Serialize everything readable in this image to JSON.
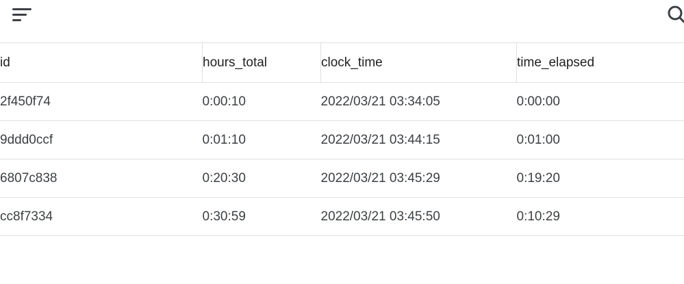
{
  "toolbar": {
    "menu_icon": "filter-list-icon",
    "search_icon": "search-icon"
  },
  "table": {
    "columns": [
      "id",
      "hours_total",
      "clock_time",
      "time_elapsed"
    ],
    "rows": [
      [
        "2f450f74",
        "0:00:10",
        "2022/03/21 03:34:05",
        "0:00:00"
      ],
      [
        "9ddd0ccf",
        "0:01:10",
        "2022/03/21 03:44:15",
        "0:01:00"
      ],
      [
        "6807c838",
        "0:20:30",
        "2022/03/21 03:45:29",
        "0:19:20"
      ],
      [
        "cc8f7334",
        "0:30:59",
        "2022/03/21 03:45:50",
        "0:10:29"
      ]
    ]
  }
}
